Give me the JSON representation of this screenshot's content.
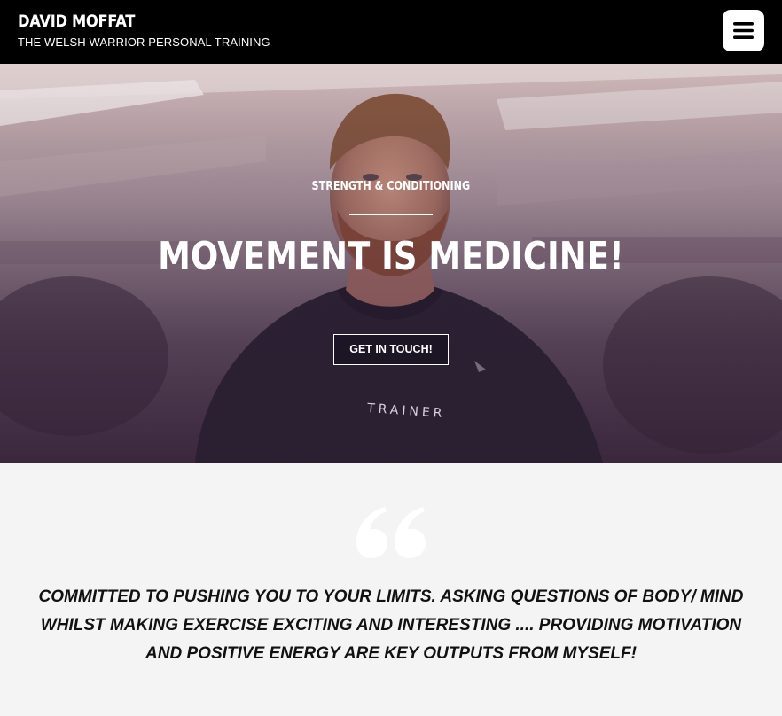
{
  "header": {
    "brand_name": "DAVID MOFFAT",
    "tagline": "THE WELSH WARRIOR PERSONAL TRAINING",
    "menu_icon": "hamburger-menu-icon"
  },
  "hero": {
    "kicker": "STRENGTH & CONDITIONING",
    "title": "MOVEMENT IS MEDICINE!",
    "cta_label": "GET IN TOUCH!",
    "shirt_text": "TRAINER",
    "overlay_color": "#3a2540"
  },
  "quote": {
    "icon": "quote-mark-icon",
    "text": "COMMITTED TO PUSHING YOU TO YOUR LIMITS. ASKING QUESTIONS OF BODY/ MIND WHILST MAKING EXERCISE EXCITING AND INTERESTING .... PROVIDING MOTIVATION AND POSITIVE ENERGY ARE KEY OUTPUTS FROM MYSELF!"
  },
  "colors": {
    "header_bg": "#000000",
    "section_bg": "#f3f4f3",
    "text_dark": "#111111",
    "text_light": "#ffffff"
  }
}
